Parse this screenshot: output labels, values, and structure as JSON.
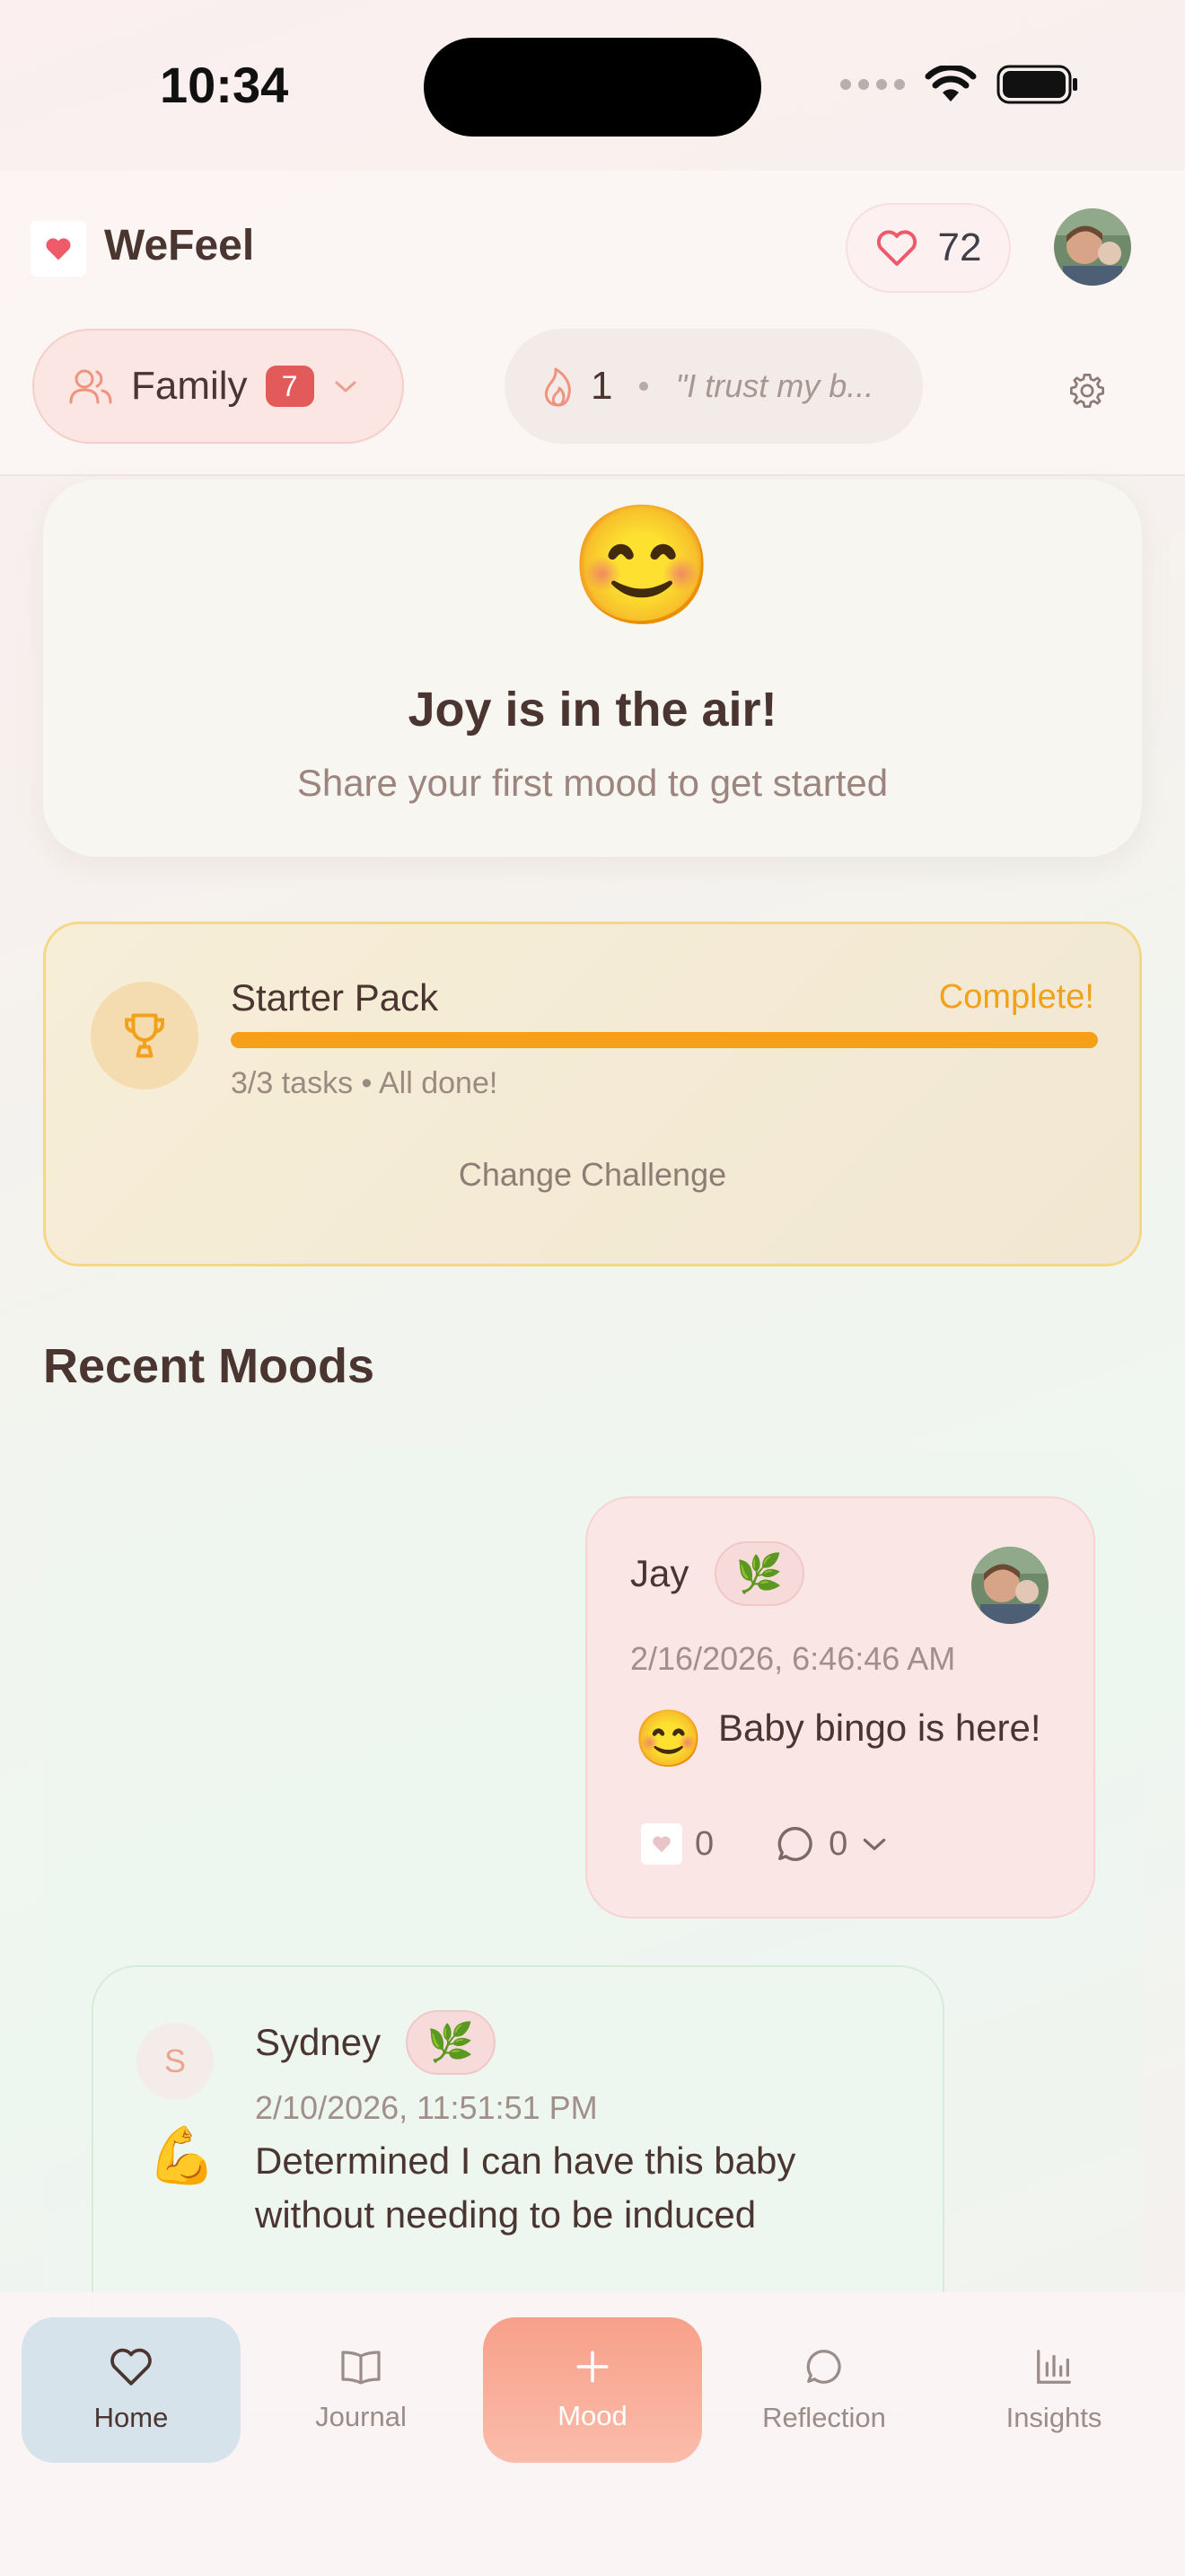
{
  "status_bar": {
    "time": "10:34"
  },
  "header": {
    "app_name": "WeFeel",
    "hearts_count": "72",
    "group": {
      "name": "Family",
      "badge": "7"
    },
    "streak": {
      "count": "1",
      "quote": "\"I trust my b..."
    }
  },
  "joy_card": {
    "emoji": "😊",
    "title": "Joy is in the air!",
    "subtitle": "Share your first mood to get started"
  },
  "challenge": {
    "title": "Starter Pack",
    "status": "Complete!",
    "progress": 1.0,
    "tasks_text": "3/3 tasks • All done!",
    "change_label": "Change Challenge"
  },
  "recent_moods": {
    "title": "Recent Moods",
    "items": [
      {
        "name": "Jay",
        "tag_emoji": "🌿",
        "date": "2/16/2026, 6:46:46 AM",
        "emoji": "😊",
        "text": "Baby bingo is here!",
        "likes": "0",
        "comments": "0"
      },
      {
        "name": "Sydney",
        "initial": "S",
        "tag_emoji": "🌿",
        "date": "2/10/2026, 11:51:51 PM",
        "emoji": "💪",
        "text_line1": "Determined I can have this baby",
        "text_line2": "without needing to be induced"
      }
    ]
  },
  "tabs": [
    {
      "label": "Home",
      "icon": "heart-icon"
    },
    {
      "label": "Journal",
      "icon": "book-icon"
    },
    {
      "label": "Mood",
      "icon": "plus-icon"
    },
    {
      "label": "Reflection",
      "icon": "chat-bubble-icon"
    },
    {
      "label": "Insights",
      "icon": "bar-chart-icon"
    }
  ],
  "colors": {
    "accent": "#f5a016",
    "badge": "#e25a5a",
    "mood_tab": "#f7a08a",
    "home_tab": "#d6e3ea"
  }
}
